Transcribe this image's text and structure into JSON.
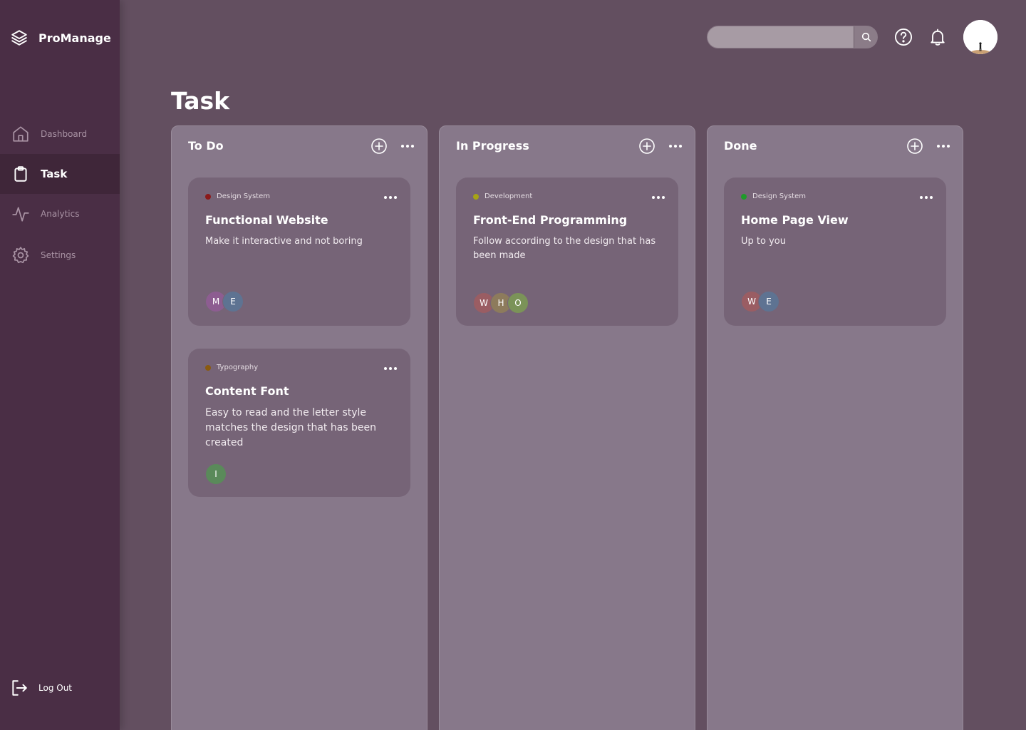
{
  "app": {
    "name": "ProManage"
  },
  "sidebar": {
    "items": [
      {
        "label": "Dashboard",
        "icon": "home-icon"
      },
      {
        "label": "Task",
        "icon": "clipboard-icon"
      },
      {
        "label": "Analytics",
        "icon": "activity-icon"
      },
      {
        "label": "Settings",
        "icon": "gear-icon"
      }
    ],
    "logout_label": "Log Out"
  },
  "header": {
    "search_value": "",
    "search_placeholder": ""
  },
  "page": {
    "title": "Task"
  },
  "columns": [
    {
      "title": "To Do",
      "cards": [
        {
          "tag": "Design System",
          "tag_color": "#8b1a1a",
          "title": "Functional Website",
          "description": "Make it interactive and not boring",
          "members": [
            {
              "initial": "M",
              "color": "#8d5d91"
            },
            {
              "initial": "E",
              "color": "#5e7392"
            }
          ]
        },
        {
          "tag": "Typography",
          "tag_color": "#8a5a10",
          "title": "Content Font",
          "description": "Easy to read and the letter style matches the design that has been created",
          "members": [
            {
              "initial": "I",
              "color": "#5a8a5a"
            }
          ]
        }
      ]
    },
    {
      "title": "In Progress",
      "cards": [
        {
          "tag": "Development",
          "tag_color": "#a6a316",
          "title": "Front-End Programming",
          "description": "Follow according to the design that has been made",
          "members": [
            {
              "initial": "W",
              "color": "#9a5d63"
            },
            {
              "initial": "H",
              "color": "#8d7b5c"
            },
            {
              "initial": "O",
              "color": "#7b9358"
            }
          ]
        }
      ]
    },
    {
      "title": "Done",
      "cards": [
        {
          "tag": "Design System",
          "tag_color": "#1f9a2a",
          "title": "Home Page View",
          "description": "Up to you",
          "members": [
            {
              "initial": "W",
              "color": "#9a5d63"
            },
            {
              "initial": "E",
              "color": "#5e7392"
            }
          ]
        }
      ]
    }
  ]
}
